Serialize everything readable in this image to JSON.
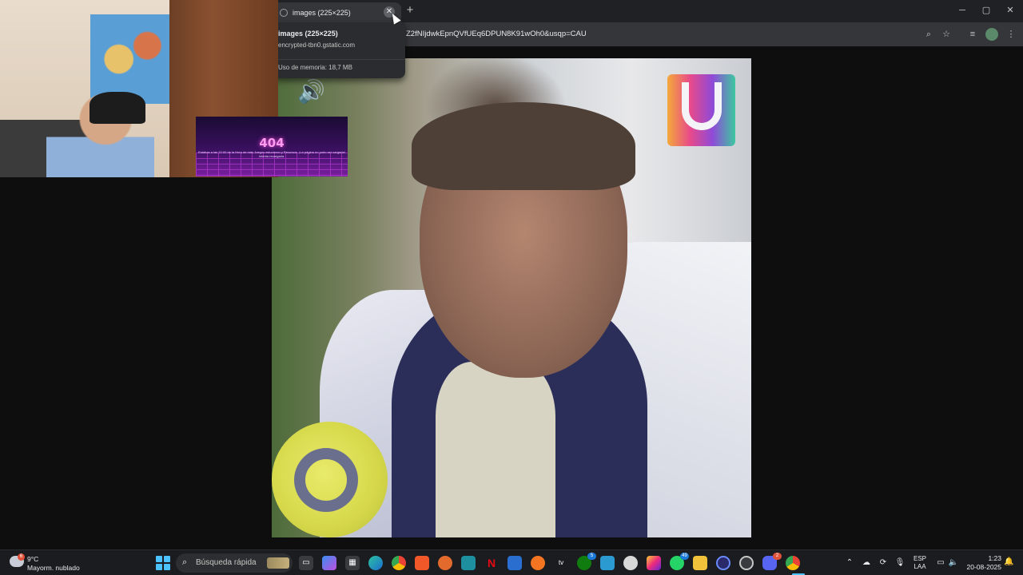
{
  "browser": {
    "tab": {
      "title": "images (225×225)",
      "close_symbol": "✕"
    },
    "new_tab_symbol": "+",
    "window_controls": {
      "minimize": "─",
      "maximize": "▢",
      "close": "✕"
    },
    "url": "Z2fNIjdwkEpnQVfUEq6DPUN8K91wOh0&usqp=CAU",
    "hover_card": {
      "title": "images (225×225)",
      "domain": "encrypted-tbn0.gstatic.com",
      "memory": "Uso de memoria: 18,7 MB"
    },
    "toolbar_icons": [
      "zoom-icon",
      "bookmark-star-icon",
      "media-icon",
      "profile-icon",
      "menu-icon"
    ]
  },
  "overlay_404": {
    "code": "404",
    "message": "Estabas a las 22:00 de la Hora de más Juegos estuvieron y Recursos. ¡La página no pudo ser cargada! Intenta recargarla."
  },
  "taskbar": {
    "weather": {
      "temp": "9°C",
      "desc": "Mayorm. nublado",
      "badge": "6"
    },
    "search_placeholder": "Búsqueda rápida",
    "apps": [
      {
        "name": "task-view",
        "badge": ""
      },
      {
        "name": "copilot",
        "badge": ""
      },
      {
        "name": "store",
        "badge": ""
      },
      {
        "name": "edge",
        "badge": ""
      },
      {
        "name": "chrome",
        "badge": ""
      },
      {
        "name": "brave",
        "badge": ""
      },
      {
        "name": "app-orange",
        "badge": ""
      },
      {
        "name": "app-teal",
        "badge": ""
      },
      {
        "name": "netflix",
        "badge": ""
      },
      {
        "name": "app-blue",
        "badge": ""
      },
      {
        "name": "crunchyroll",
        "badge": ""
      },
      {
        "name": "apple-tv",
        "badge": ""
      },
      {
        "name": "xbox",
        "badge": "5"
      },
      {
        "name": "notes",
        "badge": ""
      },
      {
        "name": "chatgpt",
        "badge": ""
      },
      {
        "name": "instagram",
        "badge": ""
      },
      {
        "name": "whatsapp",
        "badge": "49"
      },
      {
        "name": "file-explorer",
        "badge": ""
      },
      {
        "name": "app-circle",
        "badge": ""
      },
      {
        "name": "obs",
        "badge": ""
      },
      {
        "name": "discord",
        "badge": "2"
      },
      {
        "name": "chrome-active",
        "badge": ""
      }
    ],
    "lang_top": "ESP",
    "lang_bottom": "LAA",
    "time": "1:23",
    "date": "20-08-2025",
    "colors": {
      "accent": "#4cc2ff",
      "badge_red": "#e0523a"
    }
  }
}
